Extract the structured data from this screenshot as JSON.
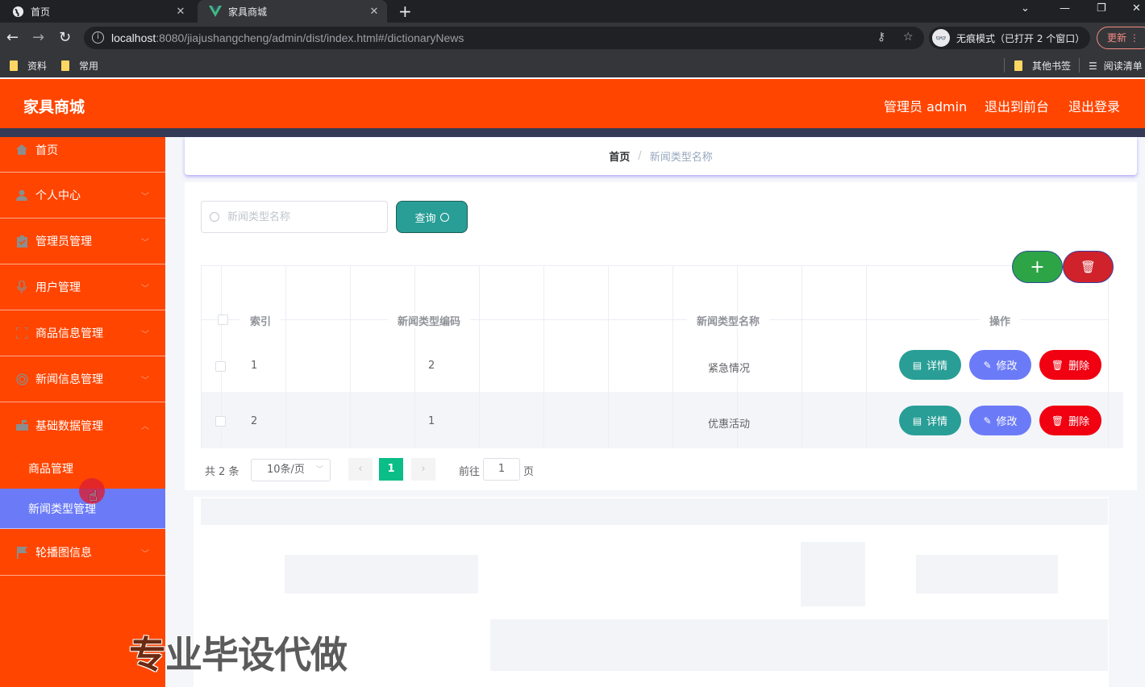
{
  "browser": {
    "tabs": [
      {
        "title": "首页",
        "icon": "globe-icon",
        "active": false
      },
      {
        "title": "家具商城",
        "icon": "vue-logo-icon",
        "active": true
      }
    ],
    "url_host": "localhost",
    "url_rest": ":8080/jiajushangcheng/admin/dist/index.html#/dictionaryNews",
    "incognito_label": "无痕模式（已打开 2 个窗口）",
    "update_label": "更新",
    "bookmarks": [
      "资料",
      "常用"
    ],
    "other_bookmarks": "其他书签",
    "reading_list": "阅读清单"
  },
  "header": {
    "brand": "家具商城",
    "user_label": "管理员 admin",
    "to_front": "退出到前台",
    "logout": "退出登录"
  },
  "sidebar": {
    "items": [
      {
        "label": "首页",
        "icon": "home-icon",
        "expandable": false
      },
      {
        "label": "个人中心",
        "icon": "user-icon",
        "expandable": true
      },
      {
        "label": "管理员管理",
        "icon": "clipboard-icon",
        "expandable": true
      },
      {
        "label": "用户管理",
        "icon": "microphone-icon",
        "expandable": true
      },
      {
        "label": "商品信息管理",
        "icon": "frame-icon",
        "expandable": true
      },
      {
        "label": "新闻信息管理",
        "icon": "ring-icon",
        "expandable": true
      },
      {
        "label": "基础数据管理",
        "icon": "mailbox-icon",
        "expandable": true,
        "expanded": true
      },
      {
        "label": "轮播图信息",
        "icon": "flag-icon",
        "expandable": true
      }
    ],
    "submenu": [
      {
        "label": "商品管理",
        "active": false
      },
      {
        "label": "新闻类型管理",
        "active": true
      }
    ]
  },
  "breadcrumb": {
    "home": "首页",
    "separator": "/",
    "current": "新闻类型名称"
  },
  "search": {
    "placeholder": "新闻类型名称",
    "value": "",
    "query_label": "查询"
  },
  "table": {
    "columns": [
      "索引",
      "新闻类型编码",
      "新闻类型名称",
      "操作"
    ],
    "rows": [
      {
        "index": "1",
        "code": "2",
        "name": "紧急情况"
      },
      {
        "index": "2",
        "code": "1",
        "name": "优惠活动"
      }
    ],
    "actions": {
      "detail": "详情",
      "edit": "修改",
      "delete": "删除"
    }
  },
  "pagination": {
    "total_label": "共 2 条",
    "page_size": "10条/页",
    "current_page": "1",
    "goto_label": "前往",
    "goto_value": "1",
    "page_suffix": "页"
  },
  "watermark": {
    "first": "专",
    "rest": "业毕设代做"
  },
  "colors": {
    "brand": "#ff4500",
    "sidebar_active": "#6b7bf7",
    "detail": "#289e96",
    "edit": "#6b7bf7",
    "delete": "#f00010",
    "add": "#2da547",
    "page_active": "#0bbd87"
  }
}
